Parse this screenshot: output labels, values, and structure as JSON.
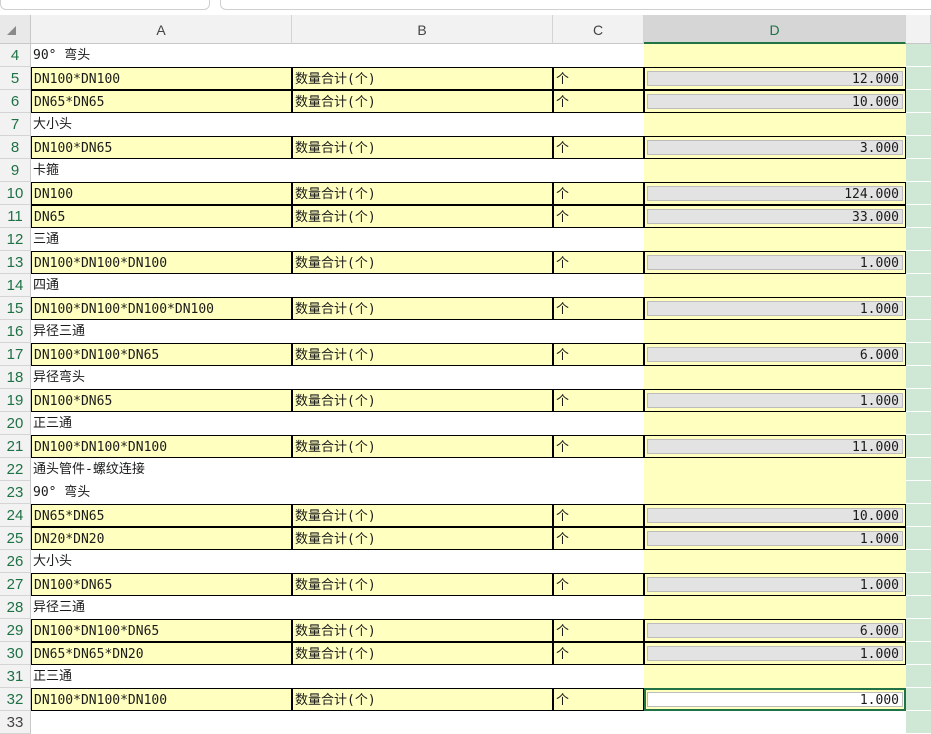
{
  "columns": [
    "A",
    "B",
    "C",
    "D"
  ],
  "selected_column": "D",
  "unit": "个",
  "qty_label": "数量合计(个)",
  "rows": [
    {
      "n": "4",
      "type": "header",
      "a": "90° 弯头"
    },
    {
      "n": "5",
      "type": "item",
      "a": "DN100*DN100",
      "d": "12.000"
    },
    {
      "n": "6",
      "type": "item",
      "a": "DN65*DN65",
      "d": "10.000"
    },
    {
      "n": "7",
      "type": "header",
      "a": "大小头"
    },
    {
      "n": "8",
      "type": "item",
      "a": "DN100*DN65",
      "d": "3.000"
    },
    {
      "n": "9",
      "type": "header",
      "a": "卡箍"
    },
    {
      "n": "10",
      "type": "item",
      "a": "DN100",
      "d": "124.000"
    },
    {
      "n": "11",
      "type": "item",
      "a": "DN65",
      "d": "33.000"
    },
    {
      "n": "12",
      "type": "header",
      "a": "三通"
    },
    {
      "n": "13",
      "type": "item",
      "a": "DN100*DN100*DN100",
      "d": "1.000"
    },
    {
      "n": "14",
      "type": "header",
      "a": "四通"
    },
    {
      "n": "15",
      "type": "item",
      "a": "DN100*DN100*DN100*DN100",
      "d": "1.000"
    },
    {
      "n": "16",
      "type": "header",
      "a": "异径三通"
    },
    {
      "n": "17",
      "type": "item",
      "a": "DN100*DN100*DN65",
      "d": "6.000"
    },
    {
      "n": "18",
      "type": "header",
      "a": "异径弯头"
    },
    {
      "n": "19",
      "type": "item",
      "a": "DN100*DN65",
      "d": "1.000"
    },
    {
      "n": "20",
      "type": "header",
      "a": "正三通"
    },
    {
      "n": "21",
      "type": "item",
      "a": "DN100*DN100*DN100",
      "d": "11.000"
    },
    {
      "n": "22",
      "type": "header",
      "a": "通头管件-螺纹连接"
    },
    {
      "n": "23",
      "type": "header",
      "a": "90° 弯头"
    },
    {
      "n": "24",
      "type": "item",
      "a": "DN65*DN65",
      "d": "10.000"
    },
    {
      "n": "25",
      "type": "item",
      "a": "DN20*DN20",
      "d": "1.000"
    },
    {
      "n": "26",
      "type": "header",
      "a": "大小头"
    },
    {
      "n": "27",
      "type": "item",
      "a": "DN100*DN65",
      "d": "1.000"
    },
    {
      "n": "28",
      "type": "header",
      "a": "异径三通"
    },
    {
      "n": "29",
      "type": "item",
      "a": "DN100*DN100*DN65",
      "d": "6.000"
    },
    {
      "n": "30",
      "type": "item",
      "a": "DN65*DN65*DN20",
      "d": "1.000"
    },
    {
      "n": "31",
      "type": "header",
      "a": "正三通"
    },
    {
      "n": "32",
      "type": "item",
      "a": "DN100*DN100*DN100",
      "d": "1.000",
      "active": true
    },
    {
      "n": "33",
      "type": "empty"
    }
  ]
}
